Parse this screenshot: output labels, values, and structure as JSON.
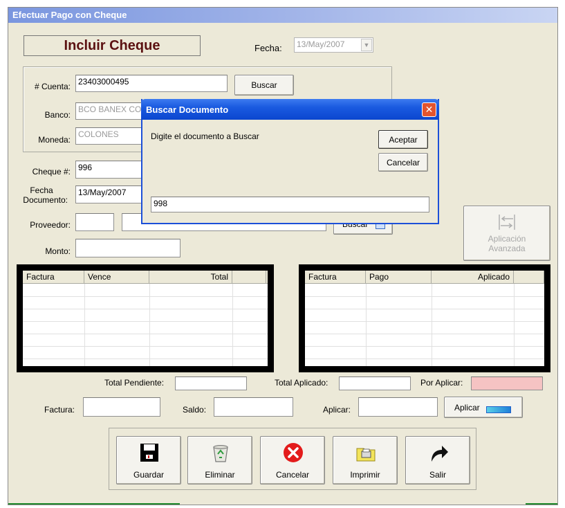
{
  "window": {
    "title": "Efectuar Pago con Cheque"
  },
  "header": {
    "heading": "Incluir Cheque",
    "fecha_label": "Fecha:",
    "fecha_value": "13/May/2007"
  },
  "account": {
    "cuenta_label": "# Cuenta:",
    "cuenta_value": "23403000495",
    "buscar_label": "Buscar",
    "banco_label": "Banco:",
    "banco_value": "BCO BANEX CO",
    "moneda_label": "Moneda:",
    "moneda_value": "COLONES"
  },
  "cheque": {
    "cheque_label": "Cheque #:",
    "cheque_value": "996",
    "fecha_doc_label_1": "Fecha",
    "fecha_doc_label_2": "Documento:",
    "fecha_doc_value": "13/May/2007",
    "proveedor_label": "Proveedor:",
    "proveedor_code": "",
    "proveedor_name": "",
    "buscar_proveedor_label": "Buscar",
    "monto_label": "Monto:",
    "monto_value": ""
  },
  "aplicacion_avanzada": {
    "line1": "Aplicación",
    "line2": "Avanzada"
  },
  "left_grid": {
    "columns": [
      "Factura",
      "Vence",
      "Total"
    ],
    "rows": []
  },
  "right_grid": {
    "columns": [
      "Factura",
      "Pago",
      "Aplicado"
    ],
    "rows": []
  },
  "totals": {
    "pendiente_label": "Total Pendiente:",
    "pendiente_value": "",
    "aplicado_label": "Total Aplicado:",
    "aplicado_value": "",
    "por_aplicar_label": "Por Aplicar:",
    "por_aplicar_value": ""
  },
  "apply_row": {
    "factura_label": "Factura:",
    "factura_value": "",
    "saldo_label": "Saldo:",
    "saldo_value": "",
    "aplicar_label": "Aplicar:",
    "aplicar_value": "",
    "aplicar_button": "Aplicar"
  },
  "toolbar": {
    "guardar": "Guardar",
    "eliminar": "Eliminar",
    "cancelar": "Cancelar",
    "imprimir": "Imprimir",
    "salir": "Salir"
  },
  "dialog": {
    "title": "Buscar Documento",
    "prompt": "Digite el documento a Buscar",
    "aceptar": "Aceptar",
    "cancelar": "Cancelar",
    "input_value": "998"
  },
  "colors": {
    "pink_field": "#f5c3c3",
    "dialog_title": "#0b46cf",
    "heading_text": "#5b1111",
    "close_button": "#e2542f"
  }
}
